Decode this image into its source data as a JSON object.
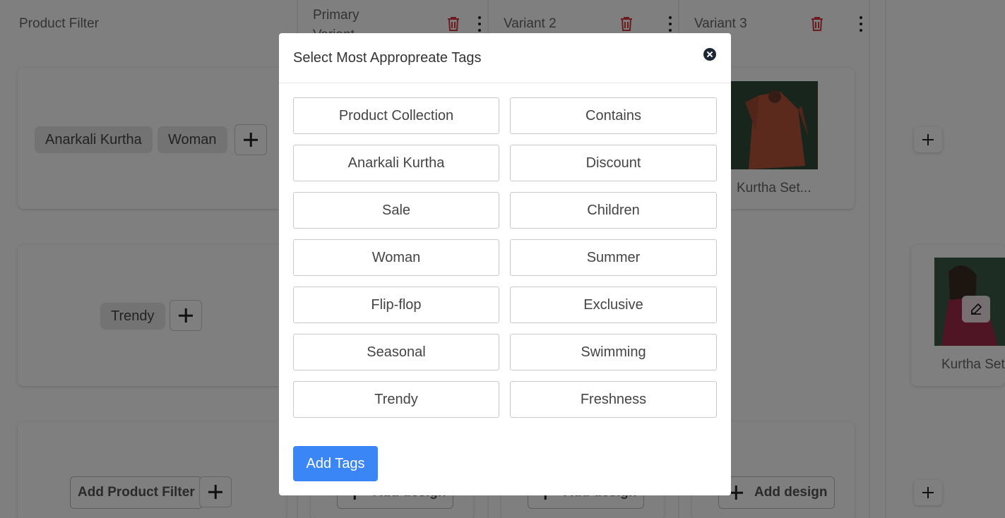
{
  "background": {
    "columns": [
      {
        "header": "Product Filter"
      },
      {
        "header": "Primary Variant"
      },
      {
        "header": "Variant 2"
      },
      {
        "header": "Variant 3"
      }
    ],
    "row1": {
      "chips": [
        "Anarkali Kurtha",
        "Woman"
      ],
      "thumb_label": "Kurtha Set..."
    },
    "row2": {
      "chips": [
        "Trendy"
      ],
      "thumb_label": "Kurtha Set"
    },
    "row3": {
      "add_filter_label": "Add Product Filter",
      "add_design_label": "Add design"
    }
  },
  "modal": {
    "title": "Select Most Appropreate Tags",
    "tags": [
      "Product Collection",
      "Contains",
      "Anarkali Kurtha",
      "Discount",
      "Sale",
      "Children",
      "Woman",
      "Summer",
      "Flip-flop",
      "Exclusive",
      "Seasonal",
      "Swimming",
      "Trendy",
      "Freshness"
    ],
    "submit_label": "Add Tags"
  },
  "colors": {
    "accent": "#3b86f7",
    "danger": "#d9363e",
    "overlay": "rgba(0,0,0,0.5)"
  }
}
